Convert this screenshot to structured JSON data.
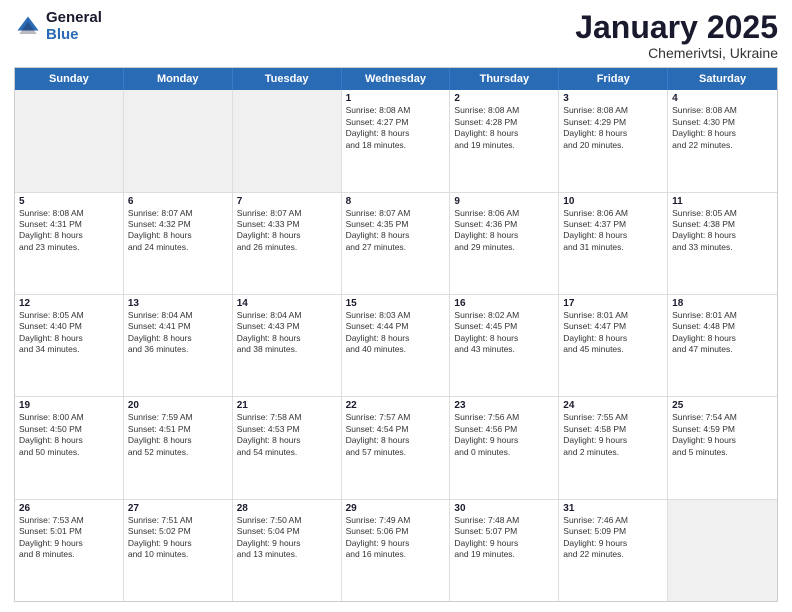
{
  "header": {
    "logo_general": "General",
    "logo_blue": "Blue",
    "month": "January 2025",
    "location": "Chemerivtsi, Ukraine"
  },
  "weekdays": [
    "Sunday",
    "Monday",
    "Tuesday",
    "Wednesday",
    "Thursday",
    "Friday",
    "Saturday"
  ],
  "rows": [
    [
      {
        "day": "",
        "text": "",
        "shaded": true
      },
      {
        "day": "",
        "text": "",
        "shaded": true
      },
      {
        "day": "",
        "text": "",
        "shaded": true
      },
      {
        "day": "1",
        "text": "Sunrise: 8:08 AM\nSunset: 4:27 PM\nDaylight: 8 hours\nand 18 minutes."
      },
      {
        "day": "2",
        "text": "Sunrise: 8:08 AM\nSunset: 4:28 PM\nDaylight: 8 hours\nand 19 minutes."
      },
      {
        "day": "3",
        "text": "Sunrise: 8:08 AM\nSunset: 4:29 PM\nDaylight: 8 hours\nand 20 minutes."
      },
      {
        "day": "4",
        "text": "Sunrise: 8:08 AM\nSunset: 4:30 PM\nDaylight: 8 hours\nand 22 minutes."
      }
    ],
    [
      {
        "day": "5",
        "text": "Sunrise: 8:08 AM\nSunset: 4:31 PM\nDaylight: 8 hours\nand 23 minutes."
      },
      {
        "day": "6",
        "text": "Sunrise: 8:07 AM\nSunset: 4:32 PM\nDaylight: 8 hours\nand 24 minutes."
      },
      {
        "day": "7",
        "text": "Sunrise: 8:07 AM\nSunset: 4:33 PM\nDaylight: 8 hours\nand 26 minutes."
      },
      {
        "day": "8",
        "text": "Sunrise: 8:07 AM\nSunset: 4:35 PM\nDaylight: 8 hours\nand 27 minutes."
      },
      {
        "day": "9",
        "text": "Sunrise: 8:06 AM\nSunset: 4:36 PM\nDaylight: 8 hours\nand 29 minutes."
      },
      {
        "day": "10",
        "text": "Sunrise: 8:06 AM\nSunset: 4:37 PM\nDaylight: 8 hours\nand 31 minutes."
      },
      {
        "day": "11",
        "text": "Sunrise: 8:05 AM\nSunset: 4:38 PM\nDaylight: 8 hours\nand 33 minutes."
      }
    ],
    [
      {
        "day": "12",
        "text": "Sunrise: 8:05 AM\nSunset: 4:40 PM\nDaylight: 8 hours\nand 34 minutes."
      },
      {
        "day": "13",
        "text": "Sunrise: 8:04 AM\nSunset: 4:41 PM\nDaylight: 8 hours\nand 36 minutes."
      },
      {
        "day": "14",
        "text": "Sunrise: 8:04 AM\nSunset: 4:43 PM\nDaylight: 8 hours\nand 38 minutes."
      },
      {
        "day": "15",
        "text": "Sunrise: 8:03 AM\nSunset: 4:44 PM\nDaylight: 8 hours\nand 40 minutes."
      },
      {
        "day": "16",
        "text": "Sunrise: 8:02 AM\nSunset: 4:45 PM\nDaylight: 8 hours\nand 43 minutes."
      },
      {
        "day": "17",
        "text": "Sunrise: 8:01 AM\nSunset: 4:47 PM\nDaylight: 8 hours\nand 45 minutes."
      },
      {
        "day": "18",
        "text": "Sunrise: 8:01 AM\nSunset: 4:48 PM\nDaylight: 8 hours\nand 47 minutes."
      }
    ],
    [
      {
        "day": "19",
        "text": "Sunrise: 8:00 AM\nSunset: 4:50 PM\nDaylight: 8 hours\nand 50 minutes."
      },
      {
        "day": "20",
        "text": "Sunrise: 7:59 AM\nSunset: 4:51 PM\nDaylight: 8 hours\nand 52 minutes."
      },
      {
        "day": "21",
        "text": "Sunrise: 7:58 AM\nSunset: 4:53 PM\nDaylight: 8 hours\nand 54 minutes."
      },
      {
        "day": "22",
        "text": "Sunrise: 7:57 AM\nSunset: 4:54 PM\nDaylight: 8 hours\nand 57 minutes."
      },
      {
        "day": "23",
        "text": "Sunrise: 7:56 AM\nSunset: 4:56 PM\nDaylight: 9 hours\nand 0 minutes."
      },
      {
        "day": "24",
        "text": "Sunrise: 7:55 AM\nSunset: 4:58 PM\nDaylight: 9 hours\nand 2 minutes."
      },
      {
        "day": "25",
        "text": "Sunrise: 7:54 AM\nSunset: 4:59 PM\nDaylight: 9 hours\nand 5 minutes."
      }
    ],
    [
      {
        "day": "26",
        "text": "Sunrise: 7:53 AM\nSunset: 5:01 PM\nDaylight: 9 hours\nand 8 minutes."
      },
      {
        "day": "27",
        "text": "Sunrise: 7:51 AM\nSunset: 5:02 PM\nDaylight: 9 hours\nand 10 minutes."
      },
      {
        "day": "28",
        "text": "Sunrise: 7:50 AM\nSunset: 5:04 PM\nDaylight: 9 hours\nand 13 minutes."
      },
      {
        "day": "29",
        "text": "Sunrise: 7:49 AM\nSunset: 5:06 PM\nDaylight: 9 hours\nand 16 minutes."
      },
      {
        "day": "30",
        "text": "Sunrise: 7:48 AM\nSunset: 5:07 PM\nDaylight: 9 hours\nand 19 minutes."
      },
      {
        "day": "31",
        "text": "Sunrise: 7:46 AM\nSunset: 5:09 PM\nDaylight: 9 hours\nand 22 minutes."
      },
      {
        "day": "",
        "text": "",
        "shaded": true
      }
    ]
  ]
}
